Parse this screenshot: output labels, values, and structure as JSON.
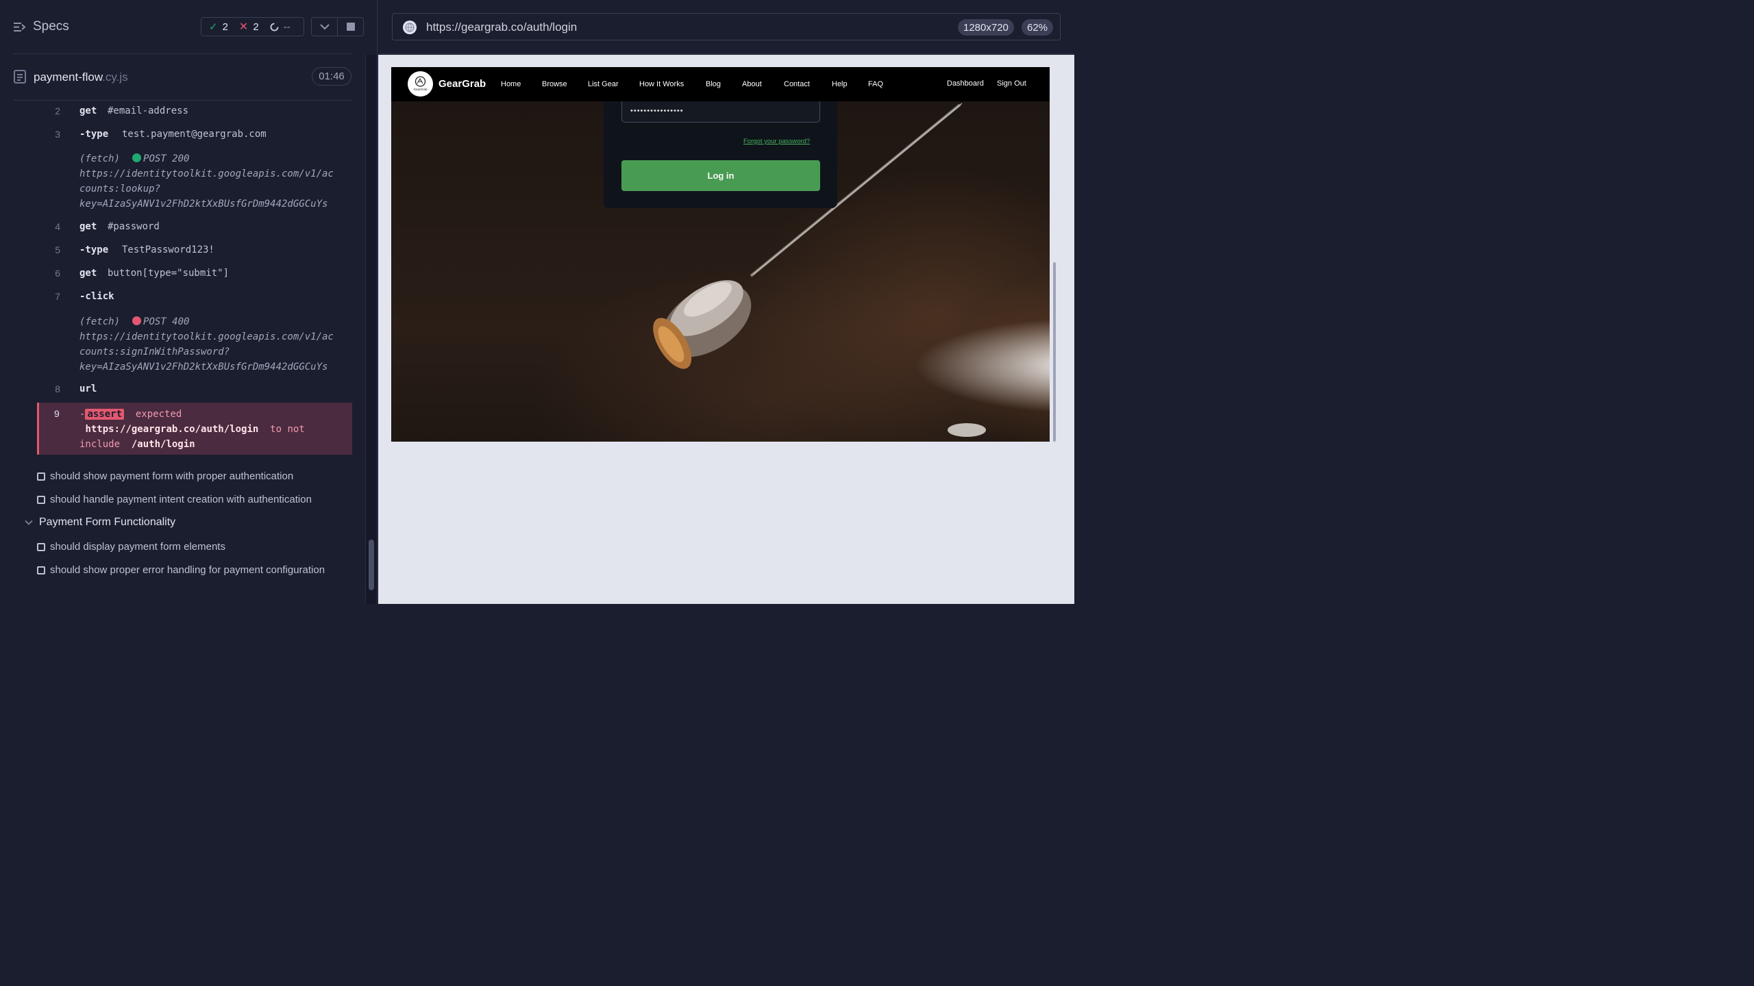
{
  "reporter": {
    "specs_label": "Specs",
    "stats": {
      "passed": "2",
      "failed": "2",
      "pending": "--"
    },
    "file": {
      "name": "payment-flow",
      "ext": ".cy.js"
    },
    "timer": "01:46",
    "commands": [
      {
        "num": "2",
        "name": "get",
        "arg": "#email-address"
      },
      {
        "num": "3",
        "name": "-type",
        "arg": "test.payment@geargrab.com"
      },
      {
        "kind": "fetch",
        "label": "(fetch)",
        "status": "POST 200",
        "status_color": "#1fa971",
        "url_lines": [
          "https://identitytoolkit.googleapis.com/v1/ac",
          "counts:lookup?",
          "key=AIzaSyANV1v2FhD2ktXxBUsfGrDm9442dGGCuYs"
        ]
      },
      {
        "num": "4",
        "name": "get",
        "arg": "#password"
      },
      {
        "num": "5",
        "name": "-type",
        "arg": "TestPassword123!"
      },
      {
        "num": "6",
        "name": "get",
        "arg": "button[type=\"submit\"]"
      },
      {
        "num": "7",
        "name": "-click",
        "arg": ""
      },
      {
        "kind": "fetch",
        "label": "(fetch)",
        "status": "POST 400",
        "status_color": "#e45770",
        "url_lines": [
          "https://identitytoolkit.googleapis.com/v1/ac",
          "counts:signInWithPassword?",
          "key=AIzaSyANV1v2FhD2ktXxBUsfGrDm9442dGGCuYs"
        ]
      },
      {
        "num": "8",
        "name": "url",
        "arg": ""
      }
    ],
    "assert": {
      "num": "9",
      "badge": "assert",
      "word_expected": "expected",
      "value": "https://geargrab.co/auth/login",
      "mid": "to not",
      "word_include": "include",
      "target": "/auth/login"
    },
    "tests": [
      "should show payment form with proper authentication",
      "should handle payment intent creation with authentication"
    ],
    "suite": "Payment Form Functionality",
    "suite_tests": [
      "should display payment form elements",
      "should show proper error handling for payment configuration"
    ]
  },
  "aut": {
    "url": "https://geargrab.co/auth/login",
    "viewport": "1280x720",
    "zoom": "62%",
    "app": {
      "brand": "GearGrab",
      "logo_caption": "GearGrab",
      "nav": [
        "Home",
        "Browse",
        "List Gear",
        "How It Works",
        "Blog",
        "About",
        "Contact",
        "Help",
        "FAQ"
      ],
      "nav_right": [
        "Dashboard",
        "Sign Out"
      ],
      "password_value": "••••••••••••••••",
      "forgot": "Forgot your password?",
      "login": "Log in"
    }
  }
}
